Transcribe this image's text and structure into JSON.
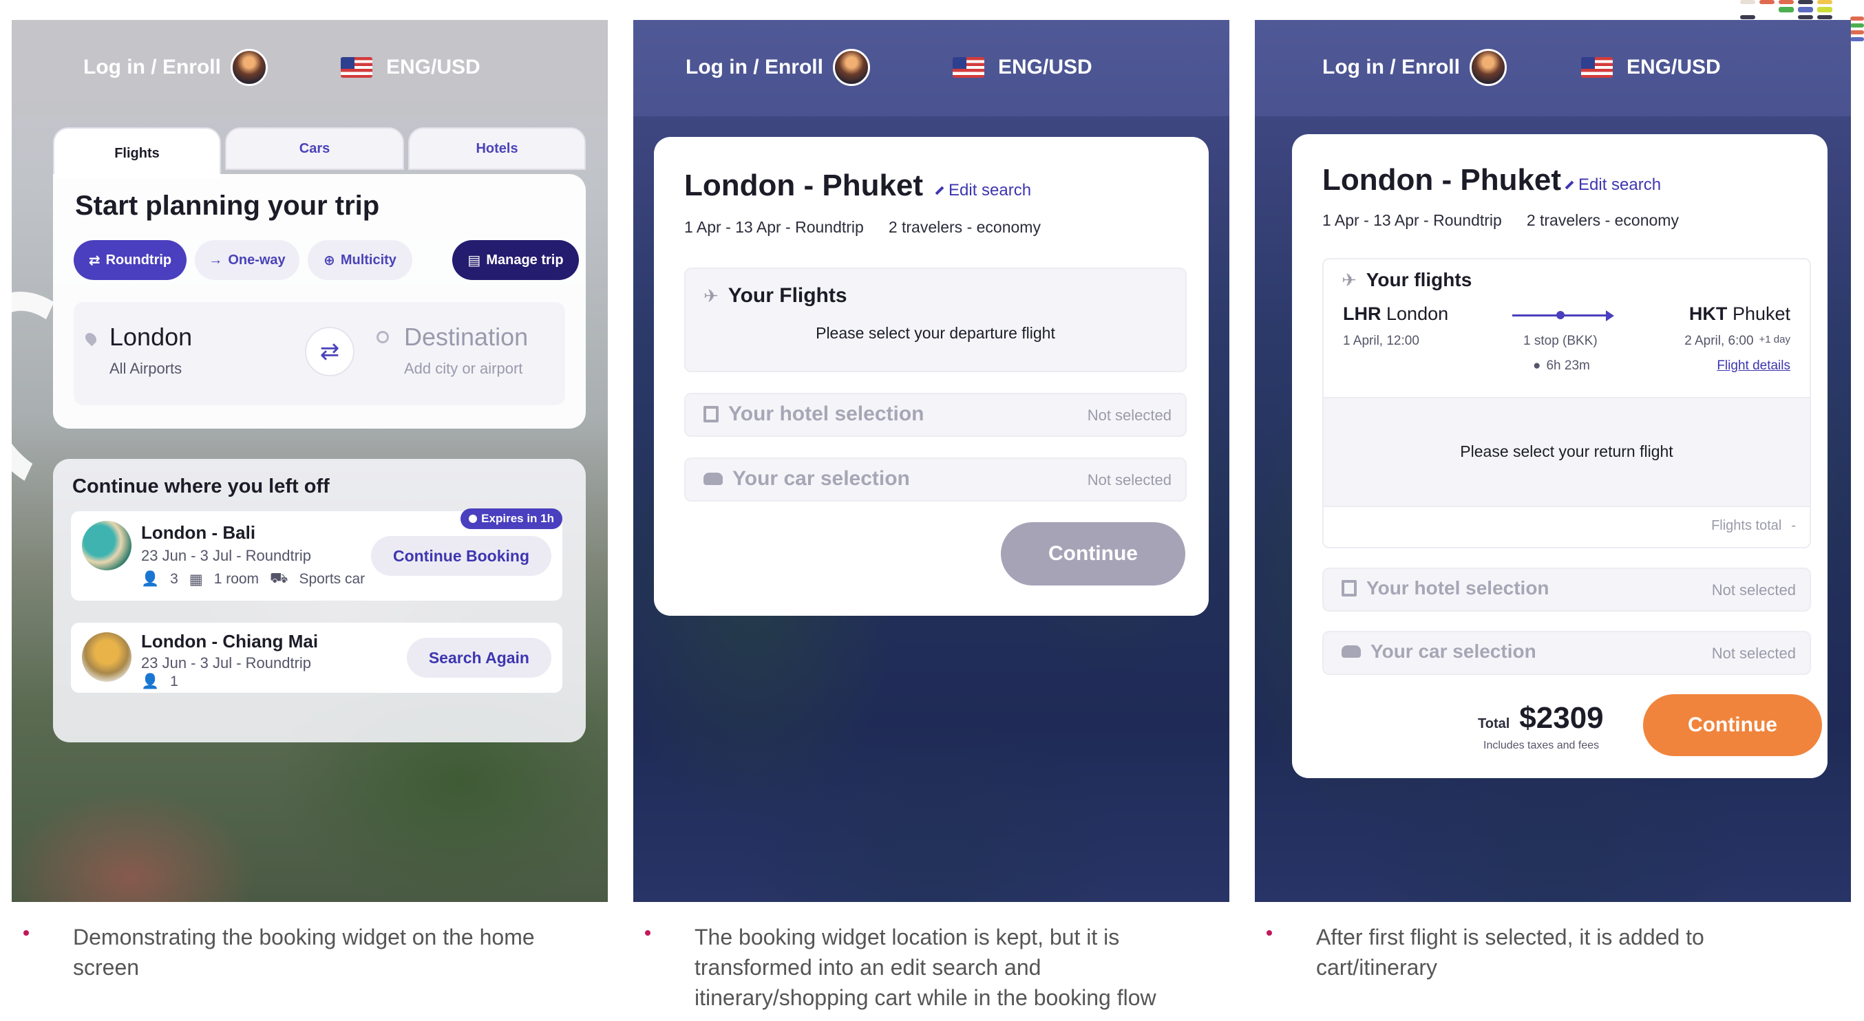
{
  "panel1": {
    "header": {
      "login": "Log in / Enroll",
      "locale": "ENG/USD"
    },
    "tabs": [
      "Flights",
      "Cars",
      "Hotels"
    ],
    "title": "Start planning your trip",
    "trip_types": {
      "roundtrip": "Roundtrip",
      "oneway": "One-way",
      "multicity": "Multicity"
    },
    "manage_trip": "Manage trip",
    "from": {
      "city": "London",
      "sub": "All Airports"
    },
    "destination": {
      "label": "Destination",
      "sub": "Add city or airport"
    },
    "continue": {
      "title": "Continue where you left off",
      "trips": [
        {
          "name": "London - Bali",
          "dates": "23 Jun - 3 Jul - Roundtrip",
          "travelers": "3",
          "rooms": "1 room",
          "car": "Sports car",
          "badge": "Expires in 1h",
          "button": "Continue Booking"
        },
        {
          "name": "London - Chiang Mai",
          "dates": "23 Jun - 3 Jul - Roundtrip",
          "travelers": "1",
          "button": "Search Again"
        }
      ]
    }
  },
  "panel2": {
    "header": {
      "login": "Log in / Enroll",
      "locale": "ENG/USD"
    },
    "title": "London - Phuket",
    "edit": "Edit search",
    "dates": "1 Apr - 13 Apr - Roundtrip",
    "travelers": "2 travelers - economy",
    "flights": {
      "title": "Your Flights",
      "message": "Please select your departure flight"
    },
    "hotel": {
      "title": "Your hotel selection",
      "status": "Not selected"
    },
    "car": {
      "title": "Your car selection",
      "status": "Not selected"
    },
    "continue": "Continue"
  },
  "panel3": {
    "header": {
      "login": "Log in / Enroll",
      "locale": "ENG/USD"
    },
    "title": "London - Phuket",
    "edit": "Edit search",
    "dates": "1 Apr - 13 Apr - Roundtrip",
    "travelers": "2 travelers - economy",
    "flights": {
      "title": "Your flights",
      "origin_code": "LHR",
      "origin_city": "London",
      "origin_time": "1 April, 12:00",
      "dest_code": "HKT",
      "dest_city": "Phuket",
      "dest_time": "2 April, 6:00",
      "dest_offset": "+1 day",
      "stops": "1 stop (BKK)",
      "duration": "6h 23m",
      "details": "Flight details",
      "return_message": "Please select your return flight",
      "total_label": "Flights total",
      "total_value": "-"
    },
    "hotel": {
      "title": "Your hotel selection",
      "status": "Not selected"
    },
    "car": {
      "title": "Your car selection",
      "status": "Not selected"
    },
    "total": {
      "label": "Total",
      "amount": "$2309",
      "note": "Includes taxes and fees"
    },
    "continue": "Continue"
  },
  "captions": [
    "Demonstrating the booking widget on the home screen",
    "The booking widget location is kept, but it is transformed into an edit search and itinerary/shopping cart while in the booking flow",
    "After first flight is selected, it is added to cart/itinerary"
  ],
  "colors": {
    "primary": "#4a3fbe",
    "dark_primary": "#241c6e",
    "orange": "#f0843c",
    "disabled": "#a6a3b7",
    "bullet": "#c2185b"
  }
}
